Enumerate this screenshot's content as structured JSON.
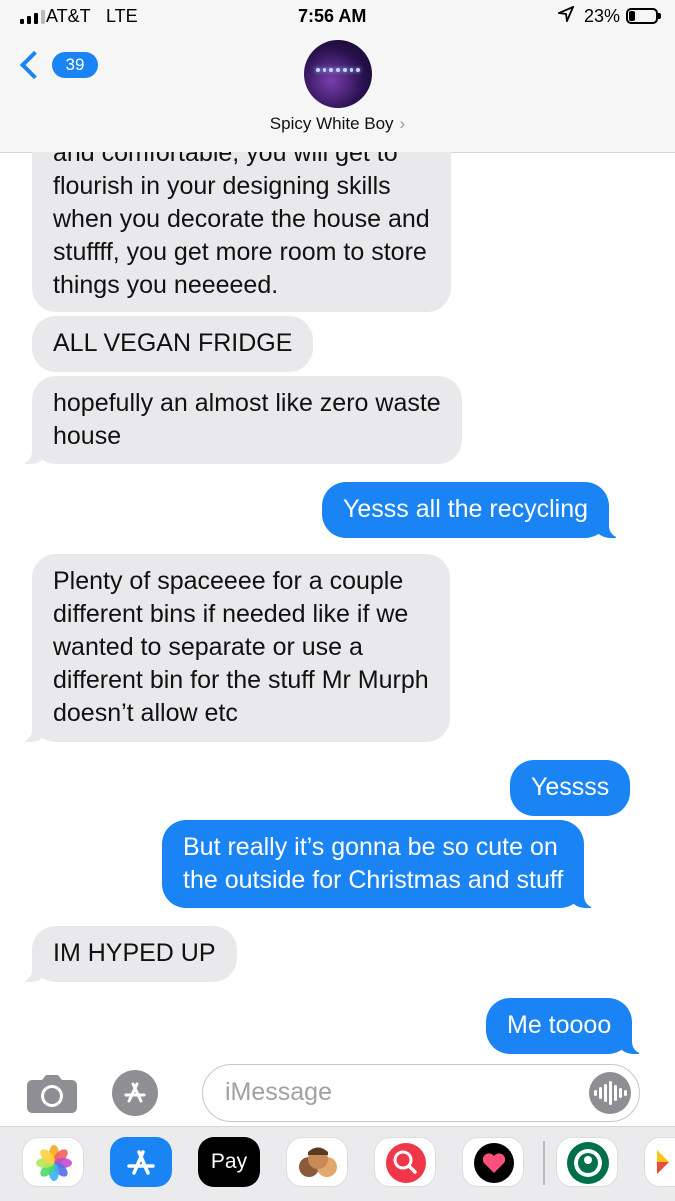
{
  "status_bar": {
    "carrier": "AT&T",
    "network": "LTE",
    "time": "7:56 AM",
    "battery_percent": "23%",
    "battery_level": 0.23,
    "signal_bars_filled": 3,
    "signal_bars_total": 4
  },
  "header": {
    "back_count": "39",
    "contact_name": "Spicy White Boy",
    "name_chevron": "›"
  },
  "messages": [
    {
      "from": "contact",
      "lines": [
        "and comfortable, you will get to",
        "flourish in your designing skills",
        "when you decorate the house and",
        "stuffff, you get more room to store",
        "things you neeeeed."
      ]
    },
    {
      "from": "contact",
      "lines": [
        "ALL VEGAN FRIDGE"
      ]
    },
    {
      "from": "contact",
      "lines": [
        "hopefully an almost like zero waste",
        "house"
      ]
    },
    {
      "from": "me",
      "lines": [
        "Yesss all the recycling"
      ]
    },
    {
      "from": "contact",
      "lines": [
        "Plenty of spaceeee for a couple",
        "different bins if needed like if we",
        "wanted to separate or use a",
        "different bin for the stuff Mr Murph",
        "doesn’t allow etc"
      ]
    },
    {
      "from": "me",
      "lines": [
        "Yessss"
      ]
    },
    {
      "from": "me",
      "lines": [
        "But really it’s gonna be so cute on",
        "the outside for Christmas and stuff"
      ]
    },
    {
      "from": "contact",
      "lines": [
        "IM HYPED UP"
      ]
    },
    {
      "from": "me",
      "lines": [
        "Me toooo"
      ]
    }
  ],
  "compose": {
    "placeholder": "iMessage",
    "camera_icon": "camera-icon",
    "apps_icon": "app-store-icon",
    "audio_icon": "audio-waveform-icon"
  },
  "app_drawer": {
    "apple_pay_label": " Pay",
    "apps": [
      "photos-icon",
      "app-store-icon",
      "apple-pay-icon",
      "memoji-icon",
      "web-search-icon",
      "heart-sticker-icon",
      "starbucks-icon",
      "partial-app-icon"
    ]
  },
  "colors": {
    "sent_bubble": "#1a84f5",
    "received_bubble": "#e9e9eb",
    "header_bg": "#f6f6f6"
  }
}
